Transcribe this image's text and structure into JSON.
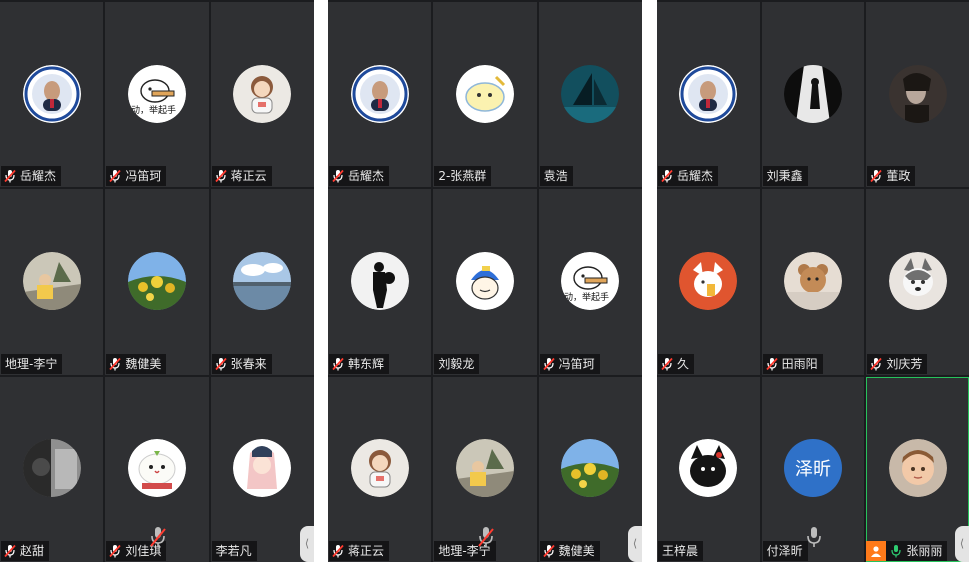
{
  "panels": [
    {
      "tiles": [
        {
          "name": "岳耀杰",
          "mic": "muted",
          "avatar": "blue-seal-portrait"
        },
        {
          "name": "冯笛珂",
          "mic": "muted",
          "avatar": "cartoon-sign"
        },
        {
          "name": "蒋正云",
          "mic": "muted",
          "avatar": "astronaut-kid"
        },
        {
          "name": "地理-李宁",
          "mic": "none",
          "avatar": "girl-with-hat"
        },
        {
          "name": "魏健美",
          "mic": "muted",
          "avatar": "yellow-flowers"
        },
        {
          "name": "张春来",
          "mic": "muted",
          "avatar": "lake-sky"
        },
        {
          "name": "赵甜",
          "mic": "muted",
          "avatar": "dark-photo"
        },
        {
          "name": "刘佳琪",
          "mic": "muted",
          "avatar": "white-mascot"
        },
        {
          "name": "李若凡",
          "mic": "none",
          "avatar": "anime-girl"
        }
      ]
    },
    {
      "tiles": [
        {
          "name": "岳耀杰",
          "mic": "muted",
          "avatar": "blue-seal-portrait"
        },
        {
          "name": "2-张燕群",
          "mic": "none",
          "avatar": "yellow-cartoon"
        },
        {
          "name": "袁浩",
          "mic": "none",
          "avatar": "sailboat-dark"
        },
        {
          "name": "韩东辉",
          "mic": "muted",
          "avatar": "silhouette-man"
        },
        {
          "name": "刘毅龙",
          "mic": "none",
          "avatar": "cap-cartoon"
        },
        {
          "name": "冯笛珂",
          "mic": "muted",
          "avatar": "cartoon-sign"
        },
        {
          "name": "蒋正云",
          "mic": "muted",
          "avatar": "astronaut-kid"
        },
        {
          "name": "地理-李宁",
          "mic": "none",
          "avatar": "girl-with-hat"
        },
        {
          "name": "魏健美",
          "mic": "muted",
          "avatar": "yellow-flowers"
        }
      ]
    },
    {
      "tiles": [
        {
          "name": "岳耀杰",
          "mic": "muted",
          "avatar": "blue-seal-portrait"
        },
        {
          "name": "刘秉鑫",
          "mic": "none",
          "avatar": "bw-figure"
        },
        {
          "name": "董政",
          "mic": "muted",
          "avatar": "bw-portrait"
        },
        {
          "name": "久",
          "mic": "muted",
          "avatar": "fox-cartoon"
        },
        {
          "name": "田雨阳",
          "mic": "muted",
          "avatar": "teddy-bear"
        },
        {
          "name": "刘庆芳",
          "mic": "muted",
          "avatar": "husky-dog"
        },
        {
          "name": "王梓晨",
          "mic": "none",
          "avatar": "black-cat"
        },
        {
          "name": "付泽昕",
          "mic": "none",
          "avatar": "initial",
          "initial": "泽昕"
        },
        {
          "name": "张丽丽",
          "mic": "active",
          "avatar": "toddler",
          "badge": "person",
          "highlight": true
        }
      ]
    }
  ],
  "colors": {
    "muted_mic": "#ff3b30",
    "active_mic": "#2ecc71",
    "tile_bg": "#2f3033",
    "active_border": "#27c25c",
    "badge": "#ff7a1a",
    "initial_bg": "#2f71c8"
  },
  "icons": {
    "muted": "mic-off-icon",
    "active": "mic-on-icon",
    "fold": "chevron-left-icon",
    "person": "person-icon"
  },
  "fold_tab_label": "⟨"
}
